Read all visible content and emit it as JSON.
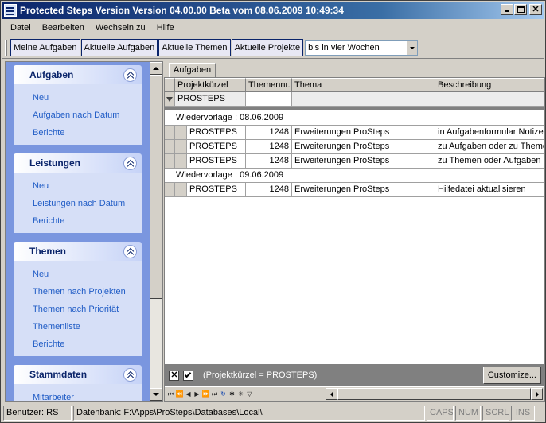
{
  "window": {
    "title": "Protected Steps Version Version 04.00.00 Beta vom 08.06.2009 10:49:34"
  },
  "menu": [
    "Datei",
    "Bearbeiten",
    "Wechseln zu",
    "Hilfe"
  ],
  "toolbar": {
    "buttons": [
      "Meine Aufgaben",
      "Aktuelle Aufgaben",
      "Aktuelle Themen",
      "Aktuelle Projekte"
    ],
    "combo_value": "bis in vier Wochen"
  },
  "nav": {
    "groups": [
      {
        "title": "Aufgaben",
        "items": [
          "Neu",
          "Aufgaben nach Datum",
          "Berichte"
        ]
      },
      {
        "title": "Leistungen",
        "items": [
          "Neu",
          "Leistungen nach Datum",
          "Berichte"
        ]
      },
      {
        "title": "Themen",
        "items": [
          "Neu",
          "Themen nach Projekten",
          "Themen nach Priorität",
          "Themenliste",
          "Berichte"
        ]
      },
      {
        "title": "Stammdaten",
        "items": [
          "Mitarbeiter"
        ]
      }
    ]
  },
  "tab": {
    "label": "Aufgaben"
  },
  "grid": {
    "columns": [
      "Projektkürzel",
      "Themennr.",
      "Thema",
      "Beschreibung"
    ],
    "filter_row": {
      "projekt": "PROSTEPS"
    },
    "groups": [
      {
        "label": "Wiedervorlage : 08.06.2009",
        "rows": [
          [
            "PROSTEPS",
            "1248",
            "Erweiterungen ProSteps",
            "in Aufgabenformular Notizen"
          ],
          [
            "PROSTEPS",
            "1248",
            "Erweiterungen ProSteps",
            "zu Aufgaben oder zu Theme"
          ],
          [
            "PROSTEPS",
            "1248",
            "Erweiterungen ProSteps",
            "zu Themen oder Aufgaben B"
          ]
        ]
      },
      {
        "label": "Wiedervorlage : 09.06.2009",
        "rows": [
          [
            "PROSTEPS",
            "1248",
            "Erweiterungen ProSteps",
            "Hilfedatei aktualisieren"
          ]
        ]
      }
    ]
  },
  "filter_bar": {
    "text": "(Projektkürzel = PROSTEPS)",
    "customize_label": "Customize..."
  },
  "status": {
    "user": "Benutzer: RS",
    "database": "Datenbank: F:\\Apps\\ProSteps\\Databases\\Local\\",
    "indicators": [
      "CAPS",
      "NUM",
      "SCRL",
      "INS"
    ]
  }
}
